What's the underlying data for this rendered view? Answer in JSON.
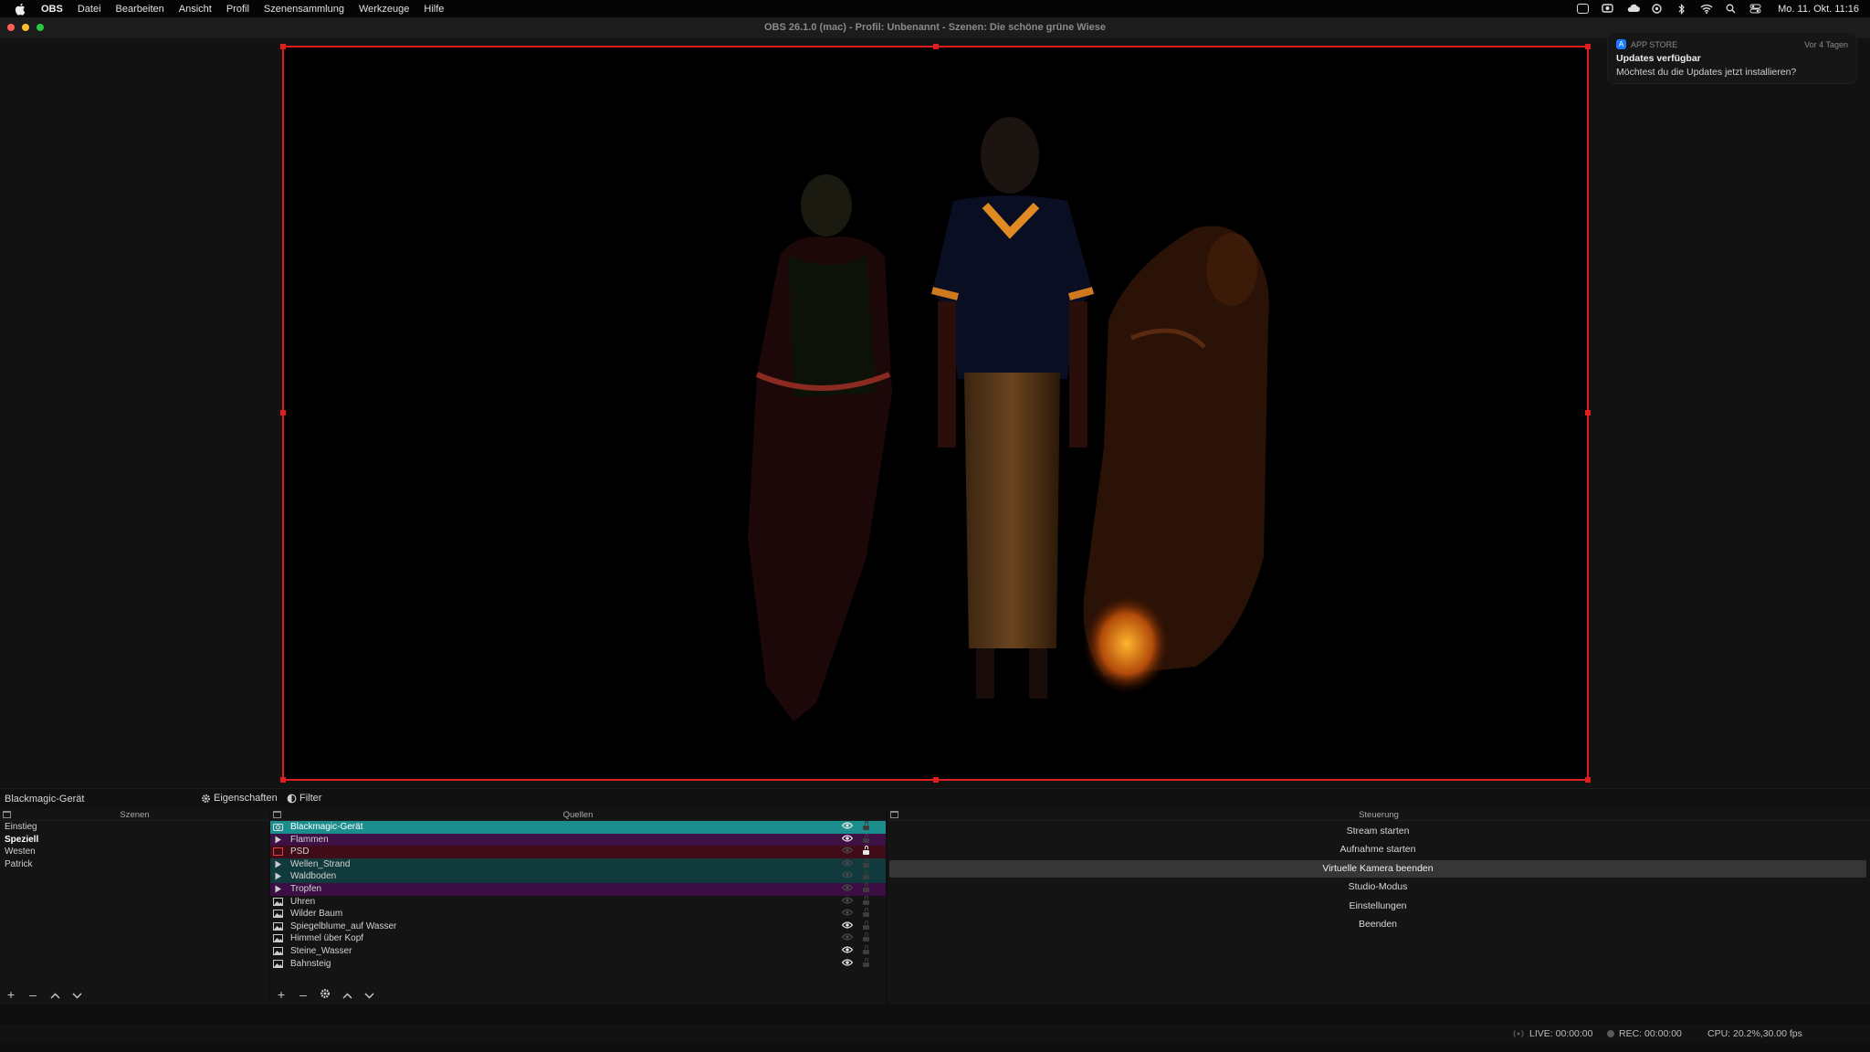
{
  "menubar": {
    "app_name": "OBS",
    "items": [
      "Datei",
      "Bearbeiten",
      "Ansicht",
      "Profil",
      "Szenensammlung",
      "Werkzeuge",
      "Hilfe"
    ],
    "clock": "Mo. 11. Okt. 11:16"
  },
  "window": {
    "title": "OBS 26.1.0 (mac) - Profil: Unbenannt - Szenen: Die schöne grüne Wiese"
  },
  "notification": {
    "app": "APP STORE",
    "when": "Vor 4 Tagen",
    "title": "Updates verfügbar",
    "body": "Möchtest du die Updates jetzt installieren?"
  },
  "context_bar": {
    "source": "Blackmagic-Gerät",
    "properties_label": "Eigenschaften",
    "filter_label": "Filter"
  },
  "scenes": {
    "title": "Szenen",
    "items": [
      {
        "label": "Einstieg",
        "selected": false
      },
      {
        "label": "Speziell",
        "selected": true
      },
      {
        "label": "Westen",
        "selected": false
      },
      {
        "label": "Patrick",
        "selected": false
      }
    ]
  },
  "sources": {
    "title": "Quellen",
    "items": [
      {
        "label": "Blackmagic-Gerät",
        "icon": "camera-icon",
        "color": "#1b8d8d",
        "visible": true,
        "locked": false
      },
      {
        "label": "Flammen",
        "icon": "play-icon",
        "color": "#3d1046",
        "visible": true,
        "locked": false
      },
      {
        "label": "PSD",
        "icon": "image-icon",
        "color": "#3f0c17",
        "visible": false,
        "locked": true
      },
      {
        "label": "Wellen_Strand",
        "icon": "play-icon",
        "color": "#113a3d",
        "visible": false,
        "locked": false
      },
      {
        "label": "Waldboden",
        "icon": "play-icon",
        "color": "#113a3d",
        "visible": false,
        "locked": false
      },
      {
        "label": "Tropfen",
        "icon": "play-icon",
        "color": "#3b0f44",
        "visible": false,
        "locked": false
      },
      {
        "label": "Uhren",
        "icon": "image-icon",
        "color": "",
        "visible": false,
        "locked": false
      },
      {
        "label": "Wilder Baum",
        "icon": "image-icon",
        "color": "",
        "visible": false,
        "locked": false
      },
      {
        "label": "Spiegelblume_auf Wasser",
        "icon": "image-icon",
        "color": "",
        "visible": true,
        "locked": false
      },
      {
        "label": "Himmel über Kopf",
        "icon": "image-icon",
        "color": "",
        "visible": false,
        "locked": false
      },
      {
        "label": "Steine_Wasser",
        "icon": "image-icon",
        "color": "",
        "visible": true,
        "locked": false
      },
      {
        "label": "Bahnsteig",
        "icon": "image-icon",
        "color": "",
        "visible": true,
        "locked": false
      }
    ]
  },
  "controls": {
    "title": "Steuerung",
    "buttons": [
      {
        "label": "Stream starten",
        "active": false
      },
      {
        "label": "Aufnahme starten",
        "active": false
      },
      {
        "label": "Virtuelle Kamera beenden",
        "active": true
      },
      {
        "label": "Studio-Modus",
        "active": false
      },
      {
        "label": "Einstellungen",
        "active": false
      },
      {
        "label": "Beenden",
        "active": false
      }
    ]
  },
  "status": {
    "live": "LIVE: 00:00:00",
    "rec": "REC: 00:00:00",
    "cpu": "CPU: 20.2%,30.00 fps"
  },
  "colors": {
    "selection_frame": "#e21d1d",
    "accent": "#1b8d8d"
  }
}
